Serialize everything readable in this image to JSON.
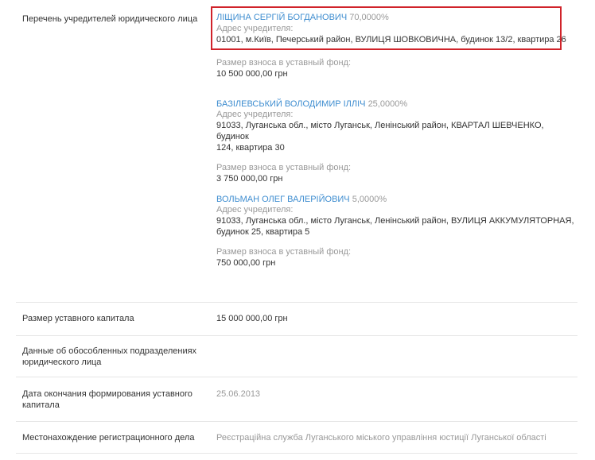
{
  "founders_section": {
    "label": "Перечень учредителей юридического лица",
    "founders": [
      {
        "name": "ЛІЩИНА СЕРГІЙ БОГДАНОВИЧ",
        "share": "70,0000%",
        "address_label": "Адрес учредителя:",
        "address_lines": [
          "01001, м.Київ, Печерський район, ВУЛИЦЯ ШОВКОВИЧНА, будинок 13/2, квартира 26"
        ],
        "contribution_label": "Размер взноса в уставный фонд:",
        "contribution_value": "10 500 000,00 грн"
      },
      {
        "name": "БАЗІЛЕВСЬКИЙ ВОЛОДИМИР ІЛЛІЧ",
        "share": "25,0000%",
        "address_label": "Адрес учредителя:",
        "address_lines": [
          "91033, Луганська обл., місто Луганськ, Ленінський район, КВАРТАЛ ШЕВЧЕНКО, будинок",
          "124, квартира 30"
        ],
        "contribution_label": "Размер взноса в уставный фонд:",
        "contribution_value": "3 750 000,00 грн"
      },
      {
        "name": "ВОЛЬМАН ОЛЕГ ВАЛЕРІЙОВИЧ",
        "share": "5,0000%",
        "address_label": "Адрес учредителя:",
        "address_lines": [
          "91033, Луганська обл., місто Луганськ, Ленінський район, ВУЛИЦЯ АККУМУЛЯТОРНАЯ,",
          "будинок 25, квартира 5"
        ],
        "contribution_label": "Размер взноса в уставный фонд:",
        "contribution_value": "750 000,00 грн"
      }
    ]
  },
  "rows": {
    "capital": {
      "label": "Размер уставного капитала",
      "value": "15 000 000,00 грн"
    },
    "subdivisions": {
      "label_lines": [
        "Данные об обособленных подразделениях",
        "юридического лица"
      ],
      "value": ""
    },
    "capital_end_date": {
      "label_lines": [
        "Дата окончания формирования уставного",
        "капитала"
      ],
      "value": "25.06.2013"
    },
    "registration_location": {
      "label": "Местонахождение регистрационного дела",
      "value": "Реєстраційна служба Луганського міського управління юстиції Луганської області"
    }
  },
  "colors": {
    "link": "#3e8dd0",
    "muted": "#999999",
    "text": "#333333",
    "highlight": "#d0232a",
    "divider": "#e6e6e6"
  }
}
